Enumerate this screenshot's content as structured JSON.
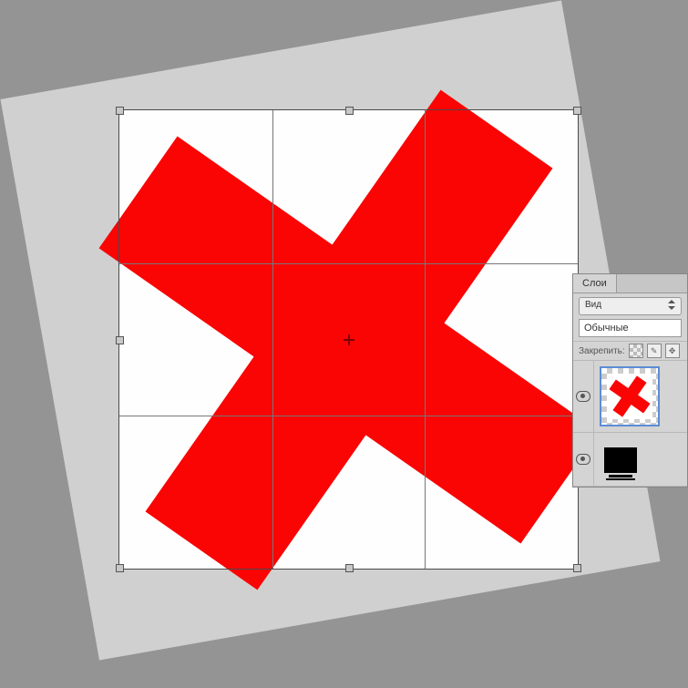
{
  "panel": {
    "tab_label": "Слои",
    "view_select_label": "Вид",
    "blend_mode_value": "Обычные",
    "lock_label": "Закрепить:"
  }
}
